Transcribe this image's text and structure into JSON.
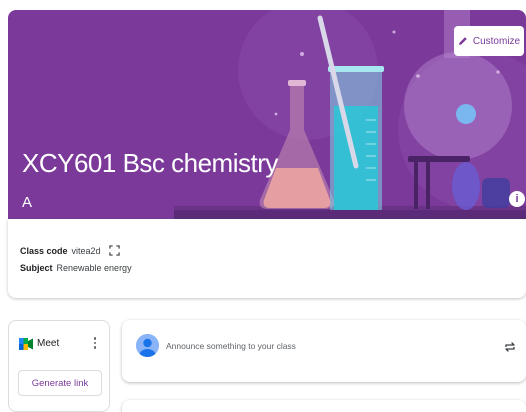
{
  "banner": {
    "title": "XCY601 Bsc chemistry",
    "section": "A",
    "customize_label": "Customize",
    "info_glyph": "i",
    "theme_color": "#7b3a9a",
    "icons": [
      "pencil-icon",
      "info-icon"
    ]
  },
  "details": {
    "class_code_label": "Class code",
    "class_code_value": "vitea2d",
    "subject_label": "Subject",
    "subject_value": "Renewable energy"
  },
  "meet": {
    "label": "Meet",
    "generate_link_label": "Generate link"
  },
  "announce": {
    "placeholder": "Announce something to your class"
  }
}
